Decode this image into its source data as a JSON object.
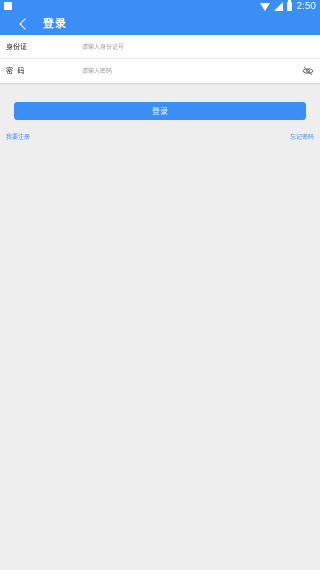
{
  "status_bar": {
    "time": "2:50",
    "icons": [
      "notification-icon",
      "wifi-icon",
      "signal-icon",
      "battery-icon"
    ]
  },
  "app_bar": {
    "title": "登录",
    "back_icon": "chevron-left-icon"
  },
  "form": {
    "id_label": "身份证",
    "id_placeholder": "请输入身份证号",
    "id_value": "",
    "password_label": "密  码",
    "password_placeholder": "请输入密码",
    "password_value": "",
    "password_toggle_icon": "eye-off-icon"
  },
  "actions": {
    "login_label": "登录",
    "register_link": "我要注册",
    "forgot_link": "忘记密码"
  },
  "colors": {
    "primary": "#3a8ef5",
    "background": "#eeeeee",
    "card": "#ffffff"
  }
}
